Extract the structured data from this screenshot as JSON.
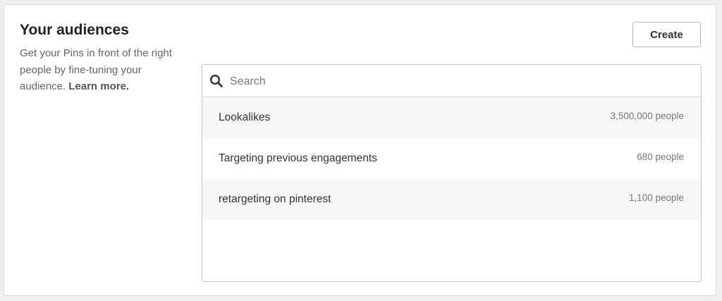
{
  "header": {
    "title": "Your audiences",
    "description": "Get your Pins in front of the right people by fine-tuning your audience.",
    "learn_more": "Learn more."
  },
  "toolbar": {
    "create_label": "Create"
  },
  "search": {
    "placeholder": "Search",
    "value": ""
  },
  "audiences": [
    {
      "name": "Lookalikes",
      "count": "3,500,000 people"
    },
    {
      "name": "Targeting previous engagements",
      "count": "680 people"
    },
    {
      "name": "retargeting on pinterest",
      "count": "1,100 people"
    }
  ],
  "icons": {
    "search": "search-icon"
  }
}
